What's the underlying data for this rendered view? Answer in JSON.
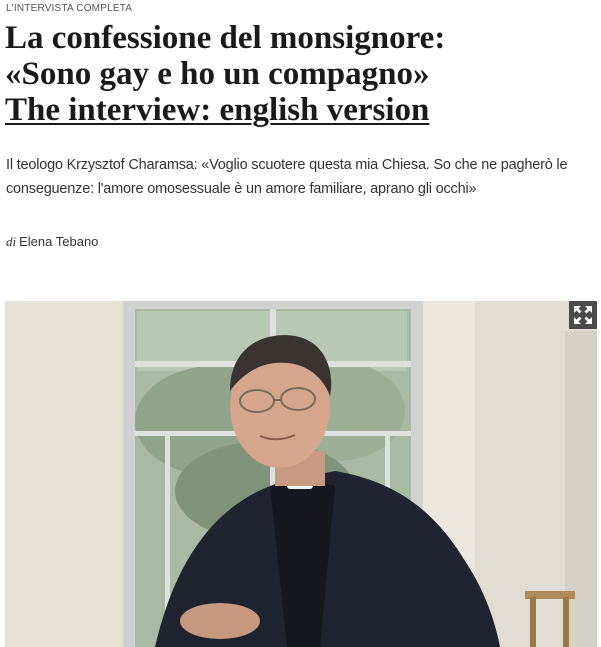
{
  "article": {
    "kicker": "L'INTERVISTA COMPLETA",
    "headline_line1": "La confessione del monsignore:",
    "headline_line2": "«Sono gay e ho un compagno»",
    "english_link": "The interview: english version",
    "summary": "Il teologo Krzysztof Charamsa: «Voglio scuotere questa mia Chiesa. So che ne pagherò le conseguenze: l'amore omosessuale è un amore familiare, aprano gli occhi»",
    "byline_prefix": "di",
    "author": "Elena Tebano"
  },
  "photo": {
    "icon": "expand-icon"
  },
  "colors": {
    "headline": "#1a1a1a",
    "text": "#333333",
    "expand_button": "#4a4a4a"
  }
}
